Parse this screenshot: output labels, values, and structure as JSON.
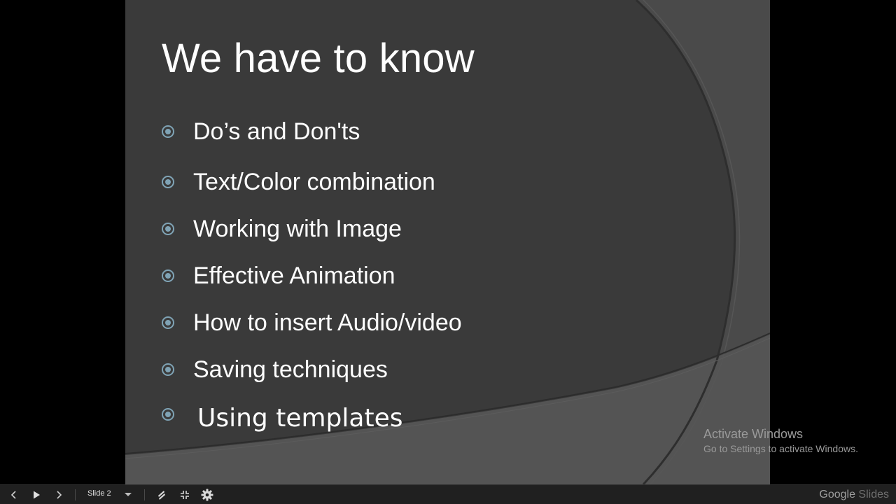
{
  "slide": {
    "title": "We have to know",
    "bullets": [
      "Do’s and Don'ts",
      "Text/Color combination",
      "Working with Image",
      "Effective Animation",
      "How to insert Audio/video",
      "Saving techniques",
      "Using templates"
    ]
  },
  "watermark": {
    "line1": "Activate Windows",
    "line2": "Go to Settings to activate Windows."
  },
  "toolbar": {
    "current_slide": "Slide 2",
    "brand_google": "Google",
    "brand_slides": "Slides",
    "icons": [
      "chevron-left-icon",
      "play-icon",
      "chevron-right-icon",
      "chevron-down-icon",
      "laser-pointer-icon",
      "exit-fullscreen-icon",
      "gear-icon"
    ]
  },
  "colors": {
    "slide_bg": "#3a3a3a",
    "bullet_ring": "#7fa3b5",
    "toolbar_bg": "#202020"
  }
}
